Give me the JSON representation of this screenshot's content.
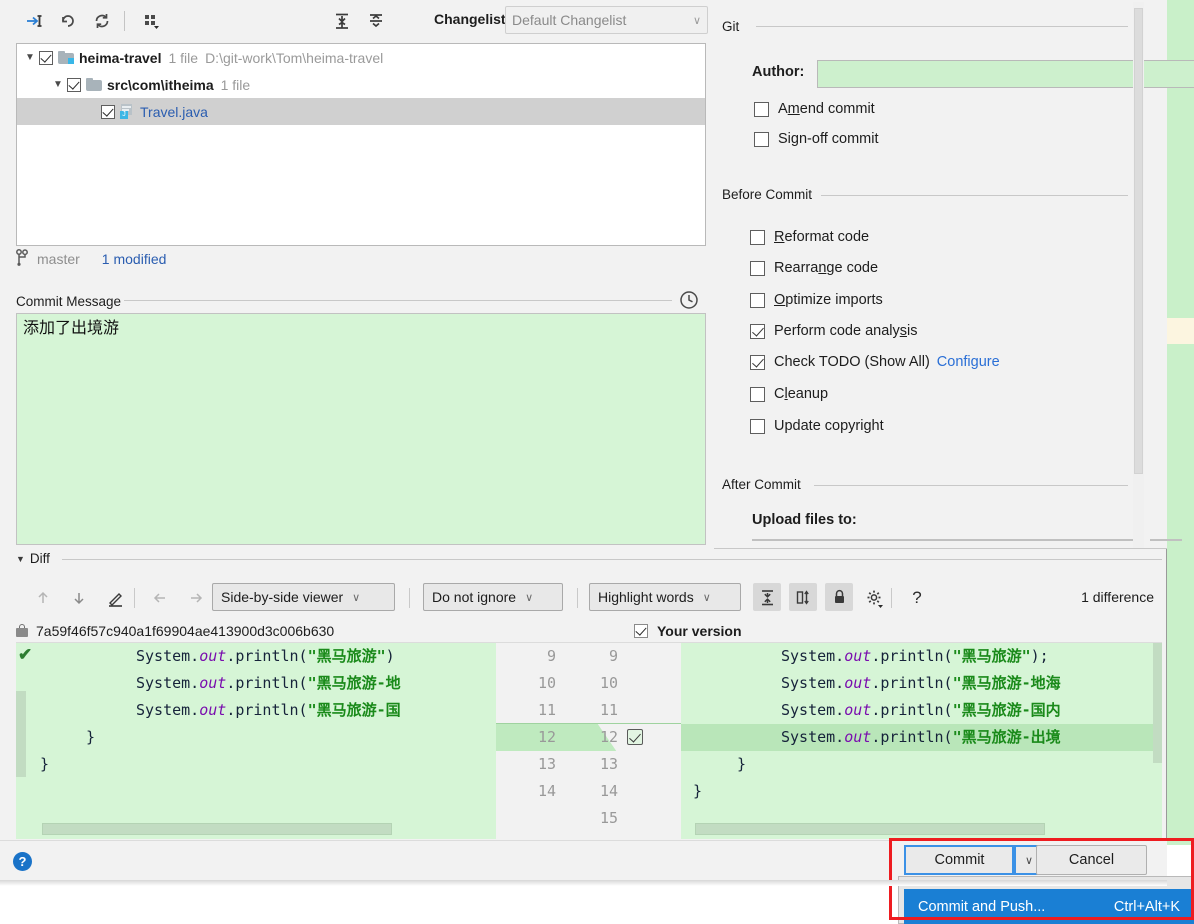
{
  "toolbar": {
    "icons": [
      {
        "name": "show-diff-icon",
        "glyph": "→‹"
      },
      {
        "name": "rollback-icon",
        "glyph": "↶"
      },
      {
        "name": "refresh-icon",
        "glyph": "↻"
      },
      {
        "name": "group-by-icon",
        "glyph": "∷"
      }
    ],
    "expand_all_icon": "expand-all-icon",
    "collapse_all_icon": "collapse-all-icon",
    "changelist_label": "Changelist:",
    "changelist_value": "Default Changelist",
    "caret": "∨"
  },
  "file_tree": {
    "rows": [
      {
        "name": "heima-travel",
        "meta": "1 file",
        "path": "D:\\git-work\\Tom\\heima-travel",
        "checked": true,
        "expanded": true,
        "icon": "project-folder-icon",
        "indent": 6,
        "selected": false,
        "is_file": false
      },
      {
        "name": "src\\com\\itheima",
        "meta": "1 file",
        "path": "",
        "checked": true,
        "expanded": true,
        "icon": "folder-icon",
        "indent": 34,
        "selected": false,
        "is_file": false
      },
      {
        "name": "Travel.java",
        "meta": "",
        "path": "",
        "checked": true,
        "expanded": null,
        "icon": "java-file-icon",
        "indent": 84,
        "selected": true,
        "is_file": true
      }
    ]
  },
  "branch_bar": {
    "icon": "branch-icon",
    "branch": "master",
    "modified_link": "1 modified"
  },
  "commit_message": {
    "section_title": "Commit Message",
    "value": "添加了出境游",
    "history_icon": "history-clock-icon"
  },
  "options": {
    "git": {
      "title": "Git",
      "author_label": "Author:",
      "author_value": "",
      "checkboxes": [
        {
          "label_pre": "A",
          "label_mnem": "m",
          "label_post": "end commit",
          "checked": false,
          "name": "amend-commit-checkbox"
        },
        {
          "label_pre": "Si",
          "label_mnem": "g",
          "label_post": "n-off commit",
          "checked": false,
          "name": "sign-off-commit-checkbox"
        }
      ]
    },
    "before_commit": {
      "title": "Before Commit",
      "checkboxes": [
        {
          "label_pre": "",
          "label_mnem": "R",
          "label_post": "eformat code",
          "checked": false,
          "name": "reformat-code-checkbox"
        },
        {
          "label_pre": "Rearra",
          "label_mnem": "n",
          "label_post": "ge code",
          "checked": false,
          "name": "rearrange-code-checkbox"
        },
        {
          "label_pre": "",
          "label_mnem": "O",
          "label_post": "ptimize imports",
          "checked": false,
          "name": "optimize-imports-checkbox"
        },
        {
          "label_pre": "Perform code analy",
          "label_mnem": "s",
          "label_post": "is",
          "checked": true,
          "name": "perform-code-analysis-checkbox"
        },
        {
          "label_pre": "Check TODO (Show All)",
          "label_mnem": "",
          "label_post": "",
          "checked": true,
          "name": "check-todo-checkbox",
          "link": "Configure"
        },
        {
          "label_pre": "C",
          "label_mnem": "l",
          "label_post": "eanup",
          "checked": false,
          "name": "cleanup-checkbox"
        },
        {
          "label_pre": "Update copyright",
          "label_mnem": "",
          "label_post": "",
          "checked": false,
          "name": "update-copyright-checkbox"
        }
      ]
    },
    "after_commit": {
      "title": "After Commit",
      "upload_label": "Upload files to:"
    }
  },
  "diff": {
    "section_title": "Diff",
    "toolbar": {
      "prev_icon": "arrow-up-icon",
      "next_icon": "arrow-down-icon",
      "edit_icon": "pencil-icon",
      "left_icon": "arrow-left-icon",
      "right_icon": "arrow-right-icon",
      "viewer_mode": "Side-by-side viewer",
      "ignore_mode": "Do not ignore",
      "highlight_mode": "Highlight words",
      "collapse_icon": "collapse-unchanged-icon",
      "align_icon": "align-changes-icon",
      "lock_icon": "lock-icon",
      "settings_icon": "gear-icon",
      "help_icon": "question-mark-icon",
      "difference_count": "1 difference",
      "caret": "∨"
    },
    "left_header": {
      "lock_icon": "lock-icon",
      "revision": "7a59f46f57c940a1f69904ae413900d3c006b630"
    },
    "right_header": {
      "checked": true,
      "label": "Your version"
    },
    "left_lines": [
      {
        "num": "9",
        "indent": 8,
        "text_pre": "System.",
        "kw": "out",
        "text_mid": ".println(",
        "str": "\"黑马旅游\"",
        "text_post": ")",
        "changed": false
      },
      {
        "num": "10",
        "indent": 8,
        "text_pre": "System.",
        "kw": "out",
        "text_mid": ".println(",
        "str": "\"黑马旅游-地",
        "text_post": "",
        "changed": false
      },
      {
        "num": "11",
        "indent": 8,
        "text_pre": "System.",
        "kw": "out",
        "text_mid": ".println(",
        "str": "\"黑马旅游-国",
        "text_post": "",
        "changed": false
      },
      {
        "num": "12",
        "indent": 4,
        "text_pre": "}",
        "kw": "",
        "text_mid": "",
        "str": "",
        "text_post": "",
        "changed": false
      },
      {
        "num": "13",
        "indent": 0,
        "text_pre": "}",
        "kw": "",
        "text_mid": "",
        "str": "",
        "text_post": "",
        "changed": false
      },
      {
        "num": "14",
        "indent": 0,
        "text_pre": "",
        "kw": "",
        "text_mid": "",
        "str": "",
        "text_post": "",
        "changed": false
      }
    ],
    "right_lines": [
      {
        "num": "9",
        "indent": 8,
        "text_pre": "System.",
        "kw": "out",
        "text_mid": ".println(",
        "str": "\"黑马旅游\"",
        "text_post": ");",
        "changed": false
      },
      {
        "num": "10",
        "indent": 8,
        "text_pre": "System.",
        "kw": "out",
        "text_mid": ".println(",
        "str": "\"黑马旅游-地海",
        "text_post": "",
        "changed": false
      },
      {
        "num": "11",
        "indent": 8,
        "text_pre": "System.",
        "kw": "out",
        "text_mid": ".println(",
        "str": "\"黑马旅游-国内",
        "text_post": "",
        "changed": false
      },
      {
        "num": "12",
        "indent": 8,
        "text_pre": "System.",
        "kw": "out",
        "text_mid": ".println(",
        "str": "\"黑马旅游-出境",
        "text_post": "",
        "changed": true
      },
      {
        "num": "13",
        "indent": 4,
        "text_pre": "}",
        "kw": "",
        "text_mid": "",
        "str": "",
        "text_post": "",
        "changed": false
      },
      {
        "num": "14",
        "indent": 0,
        "text_pre": "}",
        "kw": "",
        "text_mid": "",
        "str": "",
        "text_post": "",
        "changed": false
      },
      {
        "num": "15",
        "indent": 0,
        "text_pre": "",
        "kw": "",
        "text_mid": "",
        "str": "",
        "text_post": "",
        "changed": false
      }
    ]
  },
  "bottom": {
    "help_icon": "help-icon",
    "help_glyph": "?",
    "commit_label": "Commit",
    "commit_caret": "∨",
    "cancel_label": "Cancel",
    "menu_item_label": "Commit and Push...",
    "menu_item_shortcut": "Ctrl+Alt+K"
  },
  "colors": {
    "accent_blue": "#1a7fd4",
    "link_blue": "#2a5db0",
    "added_green": "#d6f5d6",
    "annotation_red": "#ee1c20"
  }
}
